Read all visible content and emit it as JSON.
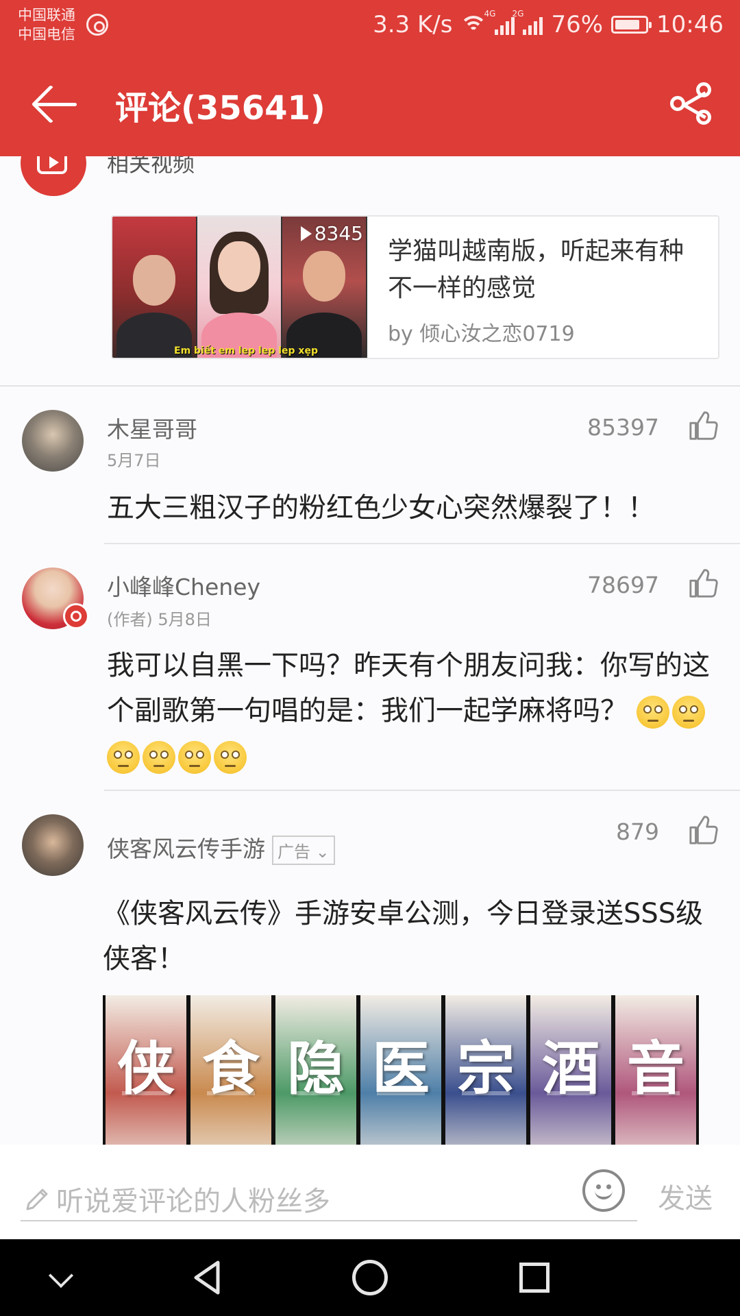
{
  "status_bar": {
    "carrier_top": "中国联通",
    "carrier_bottom": "中国电信",
    "speed": "3.3 K/s",
    "network_1": "4G",
    "network_2": "2G",
    "battery": "76%",
    "time": "10:46"
  },
  "header": {
    "title": "评论(35641)"
  },
  "related_video": {
    "section_label": "相关视频",
    "play_count": "8345",
    "caption": "Em biết em lep lep lep xẹp",
    "title": "学猫叫越南版，听起来有种不一样的感觉",
    "by": "by 倾心汝之恋0719"
  },
  "comments": [
    {
      "username": "木星哥哥",
      "meta": "5月7日",
      "likes": "85397",
      "text": "五大三粗汉子的粉红色少女心突然爆裂了！！"
    },
    {
      "username": "小峰峰Cheney",
      "meta": "(作者) 5月8日",
      "likes": "78697",
      "text": "我可以自黑一下吗？昨天有个朋友问我：你写的这个副歌第一句唱的是：我们一起学麻将吗？"
    },
    {
      "username": "侠客风云传手游",
      "ad_label": "广告",
      "likes": "879",
      "text": "《侠客风云传》手游安卓公测，今日登录送SSS级侠客！"
    }
  ],
  "ad_banner": {
    "chars": [
      "侠",
      "食",
      "隐",
      "医",
      "宗",
      "酒",
      "音"
    ],
    "colors": [
      "#c25a4f",
      "#c98a4f",
      "#4d9a67",
      "#4e7fa8",
      "#3a4f8e",
      "#6a5a9a",
      "#b0577c"
    ]
  },
  "input_bar": {
    "placeholder": "听说爱评论的人粉丝多",
    "send_label": "发送"
  },
  "colors": {
    "accent": "#dd3c37"
  }
}
